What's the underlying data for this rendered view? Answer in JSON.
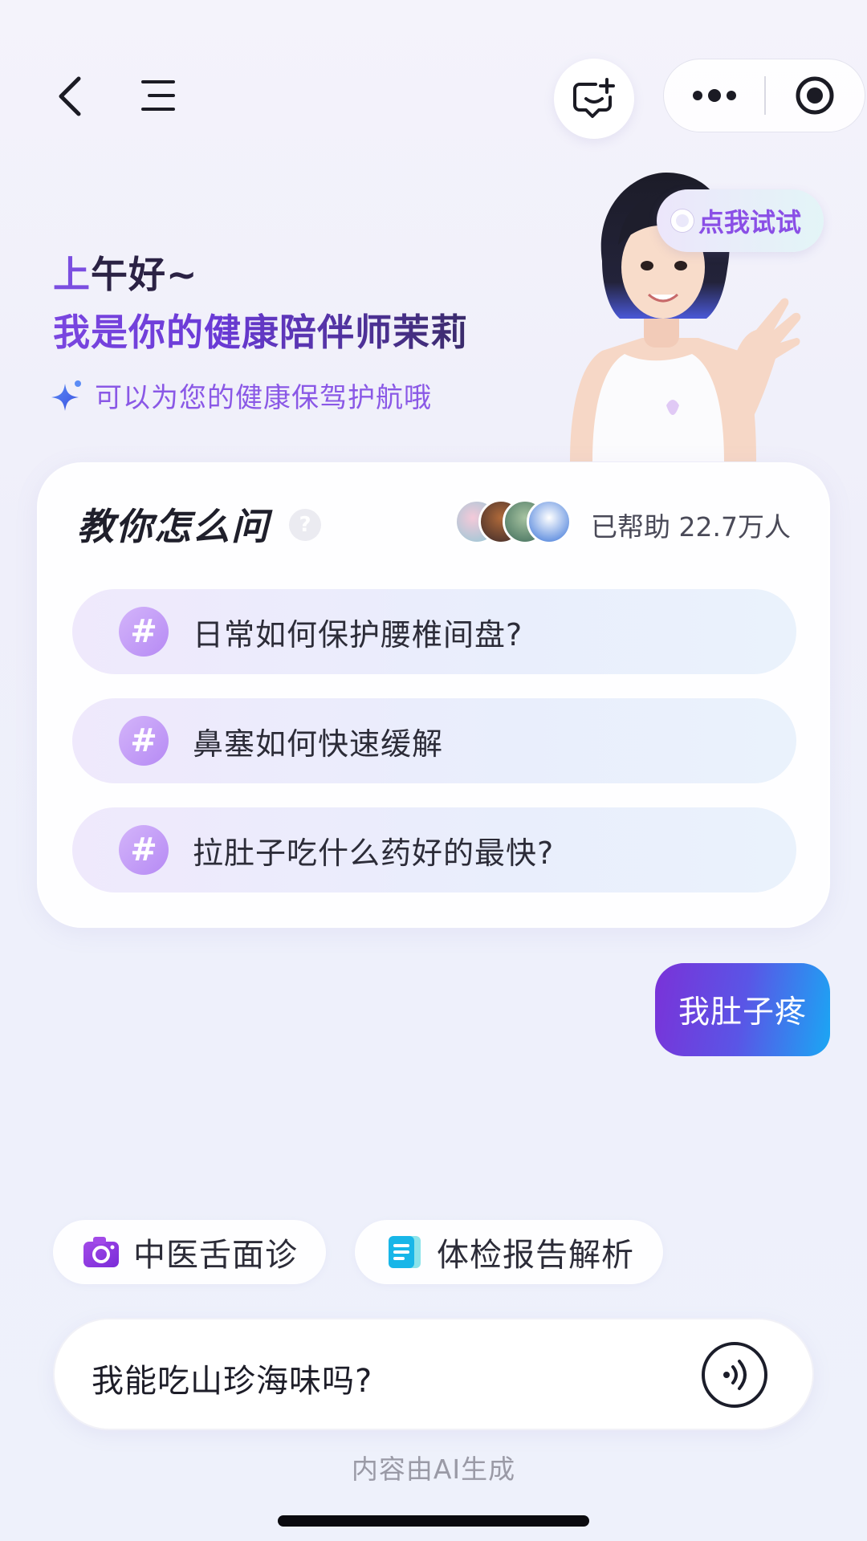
{
  "greeting": {
    "line1_accent": "上",
    "line1_rest": "午好~",
    "line2": "我是你的健康陪伴师茉莉",
    "subtitle": "可以为您的健康保驾护航哦"
  },
  "try_bubble": {
    "label": "点我试试"
  },
  "card": {
    "title": "教你怎么问",
    "help_glyph": "?",
    "helped_label": "已帮助 22.7万人",
    "questions": [
      {
        "hash": "#",
        "text": "日常如何保护腰椎间盘?"
      },
      {
        "hash": "#",
        "text": "鼻塞如何快速缓解"
      },
      {
        "hash": "#",
        "text": "拉肚子吃什么药好的最快?"
      }
    ]
  },
  "chat": {
    "user_message": "我肚子疼"
  },
  "tools": [
    {
      "label": "中医舌面诊",
      "icon": "camera-icon"
    },
    {
      "label": "体检报告解析",
      "icon": "report-icon"
    }
  ],
  "input": {
    "value": "我能吃山珍海味吗?"
  },
  "footer_note": "内容由AI生成",
  "colors": {
    "accent_purple": "#7b4ee0",
    "user_bubble_start": "#7a32d8",
    "user_bubble_end": "#1aa7f4",
    "hash_purple": "#b68af4"
  }
}
